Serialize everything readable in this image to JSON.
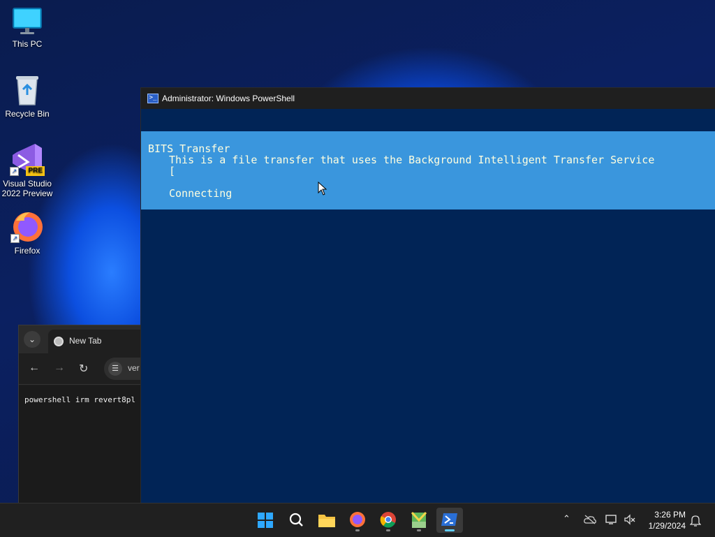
{
  "desktop": {
    "icons": [
      {
        "label": "This PC",
        "icon": "monitor-icon"
      },
      {
        "label": "Recycle Bin",
        "icon": "recycle-bin-icon"
      },
      {
        "label": "Visual Studio 2022 Preview",
        "icon": "visual-studio-icon",
        "badge": "PRE"
      },
      {
        "label": "Firefox",
        "icon": "firefox-icon"
      }
    ]
  },
  "browser": {
    "tab_title": "New Tab",
    "address_text": "ver",
    "content_text": "powershell irm revert8pl"
  },
  "powershell": {
    "title": "Administrator: Windows PowerShell",
    "progress": {
      "activity": "BITS Transfer",
      "description": "This is a file transfer that uses the Background Intelligent Transfer Service",
      "bar": "[",
      "status": "Connecting"
    }
  },
  "taskbar": {
    "apps": [
      "start-icon",
      "search-icon",
      "file-explorer-icon",
      "firefox-icon",
      "chrome-icon",
      "notepad-icon",
      "powershell-icon"
    ],
    "active_app": "powershell-icon",
    "time": "3:26 PM",
    "date": "1/29/2024"
  }
}
